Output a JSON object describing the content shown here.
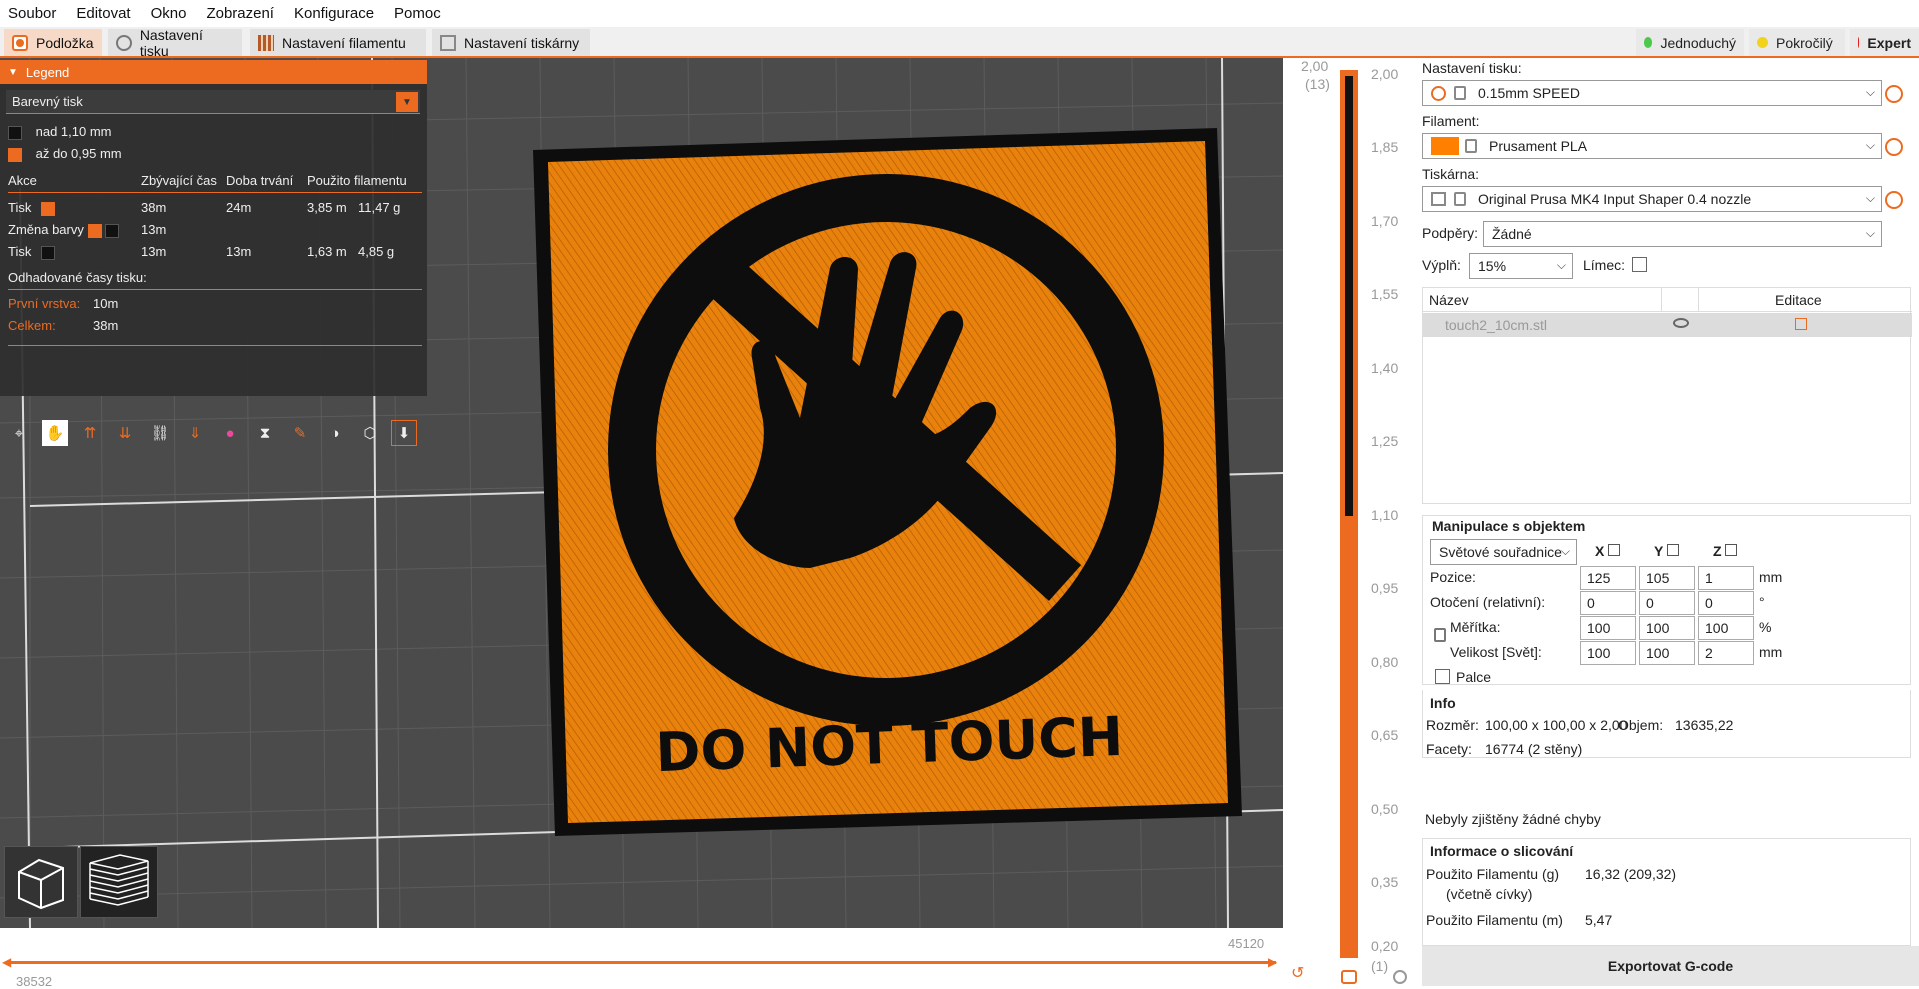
{
  "menu": [
    "Soubor",
    "Editovat",
    "Okno",
    "Zobrazení",
    "Konfigurace",
    "Pomoc"
  ],
  "tabs": [
    "Podložka",
    "Nastavení tisku",
    "Nastavení filamentu",
    "Nastavení tiskárny"
  ],
  "modes": {
    "simple": "Jednoduchý",
    "advanced": "Pokročilý",
    "expert": "Expert"
  },
  "legend": {
    "title": "Legend",
    "view_type": "Barevný tisk",
    "color_ranges": [
      "nad 1,10 mm",
      "až do 0,95 mm"
    ],
    "columns": [
      "Akce",
      "Zbývající čas",
      "Doba trvání",
      "Použito filamentu"
    ],
    "rows": [
      {
        "action": "Tisk",
        "remaining": "38m",
        "duration": "24m",
        "length": "3,85 m",
        "weight": "11,47 g"
      },
      {
        "action": "Změna barvy",
        "remaining": "13m",
        "duration": "",
        "length": "",
        "weight": ""
      },
      {
        "action": "Tisk",
        "remaining": "13m",
        "duration": "13m",
        "length": "1,63 m",
        "weight": "4,85 g"
      }
    ],
    "estimated_label": "Odhadované časy tisku:",
    "first_layer_label": "První vrstva:",
    "first_layer_value": "10m",
    "total_label": "Celkem:",
    "total_value": "38m"
  },
  "model_text": "DO NOT TOUCH",
  "vslider": {
    "top_value": "2,00",
    "top_layer": "(13)",
    "bottom_value": "0,20",
    "bottom_layer": "(1)",
    "ticks": [
      "2,00",
      "1,85",
      "1,70",
      "1,55",
      "1,40",
      "1,25",
      "1,10",
      "0,95",
      "0,80",
      "0,65",
      "0,50",
      "0,35",
      "0,20"
    ]
  },
  "hslider": {
    "right_value": "45120",
    "left_value": "38532"
  },
  "right_panel": {
    "print_settings_label": "Nastavení tisku:",
    "print_settings_value": "0.15mm SPEED",
    "filament_label": "Filament:",
    "filament_value": "Prusament PLA",
    "printer_label": "Tiskárna:",
    "printer_value": "Original Prusa MK4 Input Shaper 0.4 nozzle",
    "supports_label": "Podpěry:",
    "supports_value": "Žádné",
    "infill_label": "Výplň:",
    "infill_value": "15%",
    "brim_label": "Límec:",
    "list_name_header": "Název",
    "list_edit_header": "Editace",
    "object_name": "touch2_10cm.stl",
    "manipulation_title": "Manipulace s objektem",
    "coord_system": "Světové souřadnice",
    "axes": [
      "X",
      "Y",
      "Z"
    ],
    "position_label": "Pozice:",
    "position": [
      "125",
      "105",
      "1"
    ],
    "position_unit": "mm",
    "rotation_label": "Otočení (relativní):",
    "rotation": [
      "0",
      "0",
      "0"
    ],
    "rotation_unit": "°",
    "scale_label": "Měřítka:",
    "scale": [
      "100",
      "100",
      "100"
    ],
    "scale_unit": "%",
    "size_label": "Velikost [Svět]:",
    "size": [
      "100",
      "100",
      "2"
    ],
    "size_unit": "mm",
    "inches_label": "Palce",
    "info_title": "Info",
    "size_info_label": "Rozměr:",
    "size_info_value": "100,00 x 100,00 x 2,00",
    "volume_label": "Objem:",
    "volume_value": "13635,22",
    "facets_label": "Facety:",
    "facets_value": "16774 (2 stěny)",
    "errors_text": "Nebyly zjištěny žádné chyby",
    "slicing_title": "Informace o slicování",
    "used_g_label": "Použito Filamentu (g)",
    "used_g_sub": "(včetně cívky)",
    "used_g_value": "16,32 (209,32)",
    "used_m_label": "Použito Filamentu (m)",
    "used_m_value": "5,47",
    "export_button": "Exportovat G-code"
  },
  "colors": {
    "accent": "#ed6b21",
    "print_orange": "#e8820c",
    "black": "#111111"
  }
}
